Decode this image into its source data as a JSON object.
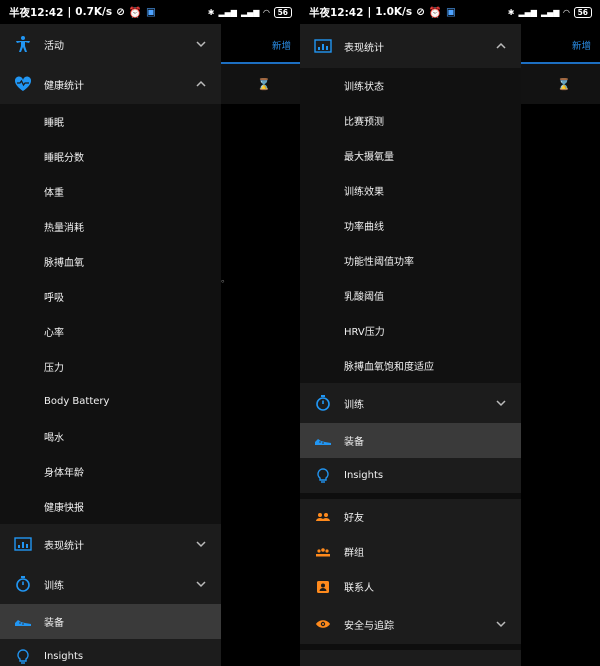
{
  "statusbar": {
    "time": "半夜12:42",
    "speed_left": "0.7K/s",
    "speed_right": "1.0K/s",
    "battery": "56"
  },
  "background_app": {
    "link_text": "新增"
  },
  "left_drawer": {
    "activity": {
      "label": "活动"
    },
    "health": {
      "label": "健康统计",
      "items": [
        "睡眠",
        "睡眠分数",
        "体重",
        "热量消耗",
        "脉搏血氧",
        "呼吸",
        "心率",
        "压力",
        "Body Battery",
        "喝水",
        "身体年龄",
        "健康快报"
      ]
    },
    "performance": {
      "label": "表现统计"
    },
    "training": {
      "label": "训练"
    },
    "gear": {
      "label": "装备"
    },
    "insights": {
      "label": "Insights"
    }
  },
  "right_drawer": {
    "performance": {
      "label": "表现统计",
      "items": [
        "训练状态",
        "比赛预测",
        "最大摄氧量",
        "训练效果",
        "功率曲线",
        "功能性阈值功率",
        "乳酸阈值",
        "HRV压力",
        "脉搏血氧饱和度适应"
      ]
    },
    "training": {
      "label": "训练"
    },
    "gear": {
      "label": "装备"
    },
    "insights": {
      "label": "Insights"
    },
    "friends": {
      "label": "好友"
    },
    "groups": {
      "label": "群组"
    },
    "contacts": {
      "label": "联系人"
    },
    "safety": {
      "label": "安全与追踪"
    }
  },
  "colors": {
    "accent_blue": "#2196f3",
    "accent_orange": "#ff8a1c",
    "drawer_bg": "#1c1c1c",
    "selected_bg": "#3a3a3a"
  }
}
